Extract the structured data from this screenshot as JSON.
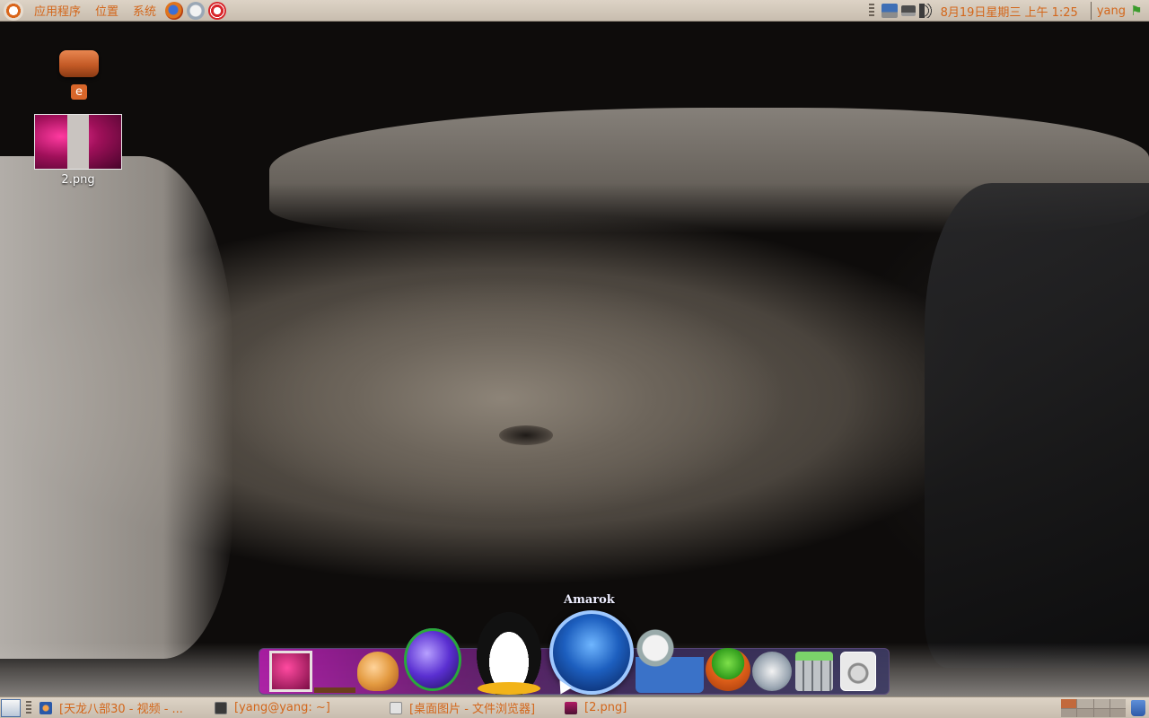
{
  "top_panel": {
    "menus": [
      "应用程序",
      "位置",
      "系统"
    ],
    "launchers": [
      "firefox-icon",
      "mail-icon",
      "help-icon"
    ],
    "clock": "8月19日星期三 上午 1:25",
    "user": "yang"
  },
  "desktop": {
    "icons": [
      {
        "label": "e",
        "type": "drive-icon"
      },
      {
        "label": "2.png",
        "type": "image-thumbnail"
      }
    ]
  },
  "dock": {
    "hover_label": "Amarok",
    "items": [
      "image-viewer-icon",
      "tree-icon",
      "shell-icon",
      "globe-icon",
      "tux-icon",
      "amarok-icon",
      "media-player-icon",
      "tomboy-icon",
      "film-icon",
      "calculator-icon",
      "disk-icon"
    ]
  },
  "taskbar": {
    "tasks": [
      {
        "label": "[天龙八部30 - 视频 - ...",
        "icon": "video-icon"
      },
      {
        "label": "[yang@yang: ~]",
        "icon": "terminal-icon"
      },
      {
        "label": "[桌面图片 - 文件浏览器]",
        "icon": "folder-icon"
      },
      {
        "label": "[2.png]",
        "icon": "image-icon"
      }
    ],
    "workspaces": 8,
    "active_workspace": 1
  },
  "colors": {
    "panel_text": "#d3661a",
    "panel_bg": "#d6ccbf"
  }
}
